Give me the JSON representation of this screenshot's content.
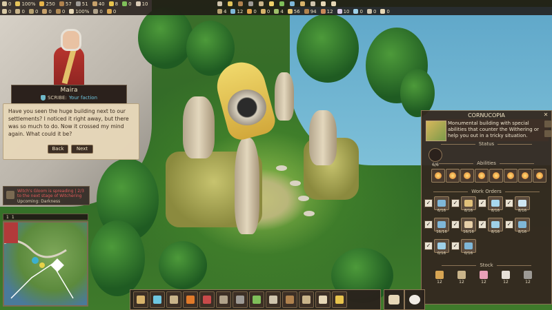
{
  "topbar": {
    "row1": [
      {
        "icon": "population-icon",
        "value": "0",
        "color": "#d8c9a5"
      },
      {
        "icon": "happiness-icon",
        "value": "100%",
        "color": "#e6c45a"
      },
      {
        "icon": "food-icon",
        "value": "250",
        "color": "#e7b44a"
      },
      {
        "icon": "wood-icon",
        "value": "57",
        "color": "#b0824e"
      },
      {
        "icon": "stone-icon",
        "value": "51",
        "color": "#9d9a95"
      },
      {
        "icon": "tool-icon",
        "value": "40",
        "color": "#c7a16b"
      },
      {
        "icon": "coin-icon",
        "value": "8",
        "color": "#e8c44d"
      },
      {
        "icon": "leaf-icon",
        "value": "0",
        "color": "#7fbf5a"
      },
      {
        "icon": "cloth-icon",
        "value": "10",
        "color": "#d9c9b5"
      }
    ],
    "row2": [
      {
        "icon": "scribe-icon",
        "value": "0",
        "color": "#d8c9a5"
      },
      {
        "icon": "worker-icon",
        "value": "0",
        "color": "#c9b48a"
      },
      {
        "icon": "explorer-icon",
        "value": "0",
        "color": "#b6a070"
      },
      {
        "icon": "trader-icon",
        "value": "0",
        "color": "#c7a16b"
      },
      {
        "icon": "crafter-icon",
        "value": "0",
        "color": "#b08a55"
      },
      {
        "icon": "vitality-icon",
        "value": "100%",
        "color": "#e6d7b6"
      },
      {
        "icon": "building-icon",
        "value": "0",
        "color": "#b0a28a"
      },
      {
        "icon": "bread-icon",
        "value": "0",
        "color": "#d7a553"
      }
    ],
    "right": [
      {
        "icon": "hammer-icon",
        "value": "",
        "color": "#cfc4ad"
      },
      {
        "icon": "wheat-icon",
        "value": "",
        "color": "#e2c45a"
      },
      {
        "icon": "log-icon",
        "value": "",
        "color": "#b0824e"
      },
      {
        "icon": "ore-icon",
        "value": "",
        "color": "#9d9a95"
      },
      {
        "icon": "pick-icon",
        "value": "",
        "color": "#c9b48a"
      },
      {
        "icon": "sun-icon",
        "value": "",
        "color": "#f0d06a"
      },
      {
        "icon": "herb-icon",
        "value": "",
        "color": "#7fbf5a"
      },
      {
        "icon": "gem-icon",
        "value": "",
        "color": "#7fb7d8"
      },
      {
        "icon": "trade-icon",
        "value": "",
        "color": "#d7b36b"
      },
      {
        "icon": "swords-icon",
        "value": "",
        "color": "#cfc4ad"
      },
      {
        "icon": "scroll-icon",
        "value": "",
        "color": "#e6d7b6"
      },
      {
        "icon": "menu-icon",
        "value": "",
        "color": "#e6d7b6"
      }
    ],
    "right2": [
      {
        "icon": "sap-icon",
        "value": "4",
        "color": "#b6a070"
      },
      {
        "icon": "glass-icon",
        "value": "12",
        "color": "#7fb7d8"
      },
      {
        "icon": "amber-icon",
        "value": "0",
        "color": "#e2a04a"
      },
      {
        "icon": "grain-icon",
        "value": "0",
        "color": "#d7b36b"
      },
      {
        "icon": "fiber-icon",
        "value": "4",
        "color": "#9fbf6a"
      },
      {
        "icon": "candle-icon",
        "value": "56",
        "color": "#e7c46a"
      },
      {
        "icon": "plank-icon",
        "value": "94",
        "color": "#b0824e"
      },
      {
        "icon": "clay-icon",
        "value": "12",
        "color": "#c98a5a"
      },
      {
        "icon": "silk-icon",
        "value": "10",
        "color": "#d9c9e5"
      },
      {
        "icon": "crystal-icon",
        "value": "0",
        "color": "#9fd0e8"
      },
      {
        "icon": "relic-icon",
        "value": "0",
        "color": "#cfc4ad"
      },
      {
        "icon": "book-icon",
        "value": "0",
        "color": "#e6d7b6"
      }
    ]
  },
  "character": {
    "name": "Maira",
    "role_prefix": "SCRIBE:",
    "role_faction": "Your faction"
  },
  "dialog": {
    "text": "Have you seen the huge building next to our settlements? I noticed it right away, but there was so much to do. Now it crossed my mind again. What could it be?",
    "back_label": "Back",
    "next_label": "Next"
  },
  "notification": {
    "line1": "Witch's Gloom is spreading | 2/3 to the next stage of Witchering",
    "line2": "Upcoming: Darkness"
  },
  "minimap": {
    "level": "1",
    "speed": "1"
  },
  "cornucopia": {
    "title": "CORNUCOPIA",
    "description": "Monumental building with special abilities that counter the Withering or help you out in a tricky situation.",
    "status_label": "Status",
    "status_value": "6/6",
    "abilities_label": "Abilities",
    "abilities": [
      {
        "icon": "ability-sun-icon"
      },
      {
        "icon": "ability-gem-icon"
      },
      {
        "icon": "ability-wind-icon"
      },
      {
        "icon": "ability-bloom-icon"
      },
      {
        "icon": "ability-shield-icon"
      },
      {
        "icon": "ability-flame-icon"
      },
      {
        "icon": "ability-star-icon"
      },
      {
        "icon": "ability-spark-icon"
      }
    ],
    "work_orders_label": "Work Orders",
    "work_orders": [
      {
        "icon": "order-house-icon",
        "count": "6/16",
        "color": "#7fb7d8"
      },
      {
        "icon": "order-fence-icon",
        "count": "8/16",
        "color": "#e0c07a"
      },
      {
        "icon": "order-crystal-icon",
        "count": "8/16",
        "color": "#a8d8ee"
      },
      {
        "icon": "order-cube-icon",
        "count": "8/16",
        "color": "#cfe6f2"
      },
      {
        "icon": "order-ring-icon",
        "count": "16/16",
        "color": "#7fb7d8"
      },
      {
        "icon": "order-shell-icon",
        "count": "16/16",
        "color": "#e7cfa8"
      },
      {
        "icon": "order-pearl-icon",
        "count": "8/16",
        "color": "#9fd0e8"
      },
      {
        "icon": "order-orb-icon",
        "count": "8/16",
        "color": "#7fb7d8"
      },
      {
        "icon": "order-potion-icon",
        "count": "0/16",
        "color": "#9fd0e8"
      },
      {
        "icon": "order-flask-icon",
        "count": "0/16",
        "color": "#7fb7d8"
      }
    ],
    "stock_label": "Stock",
    "stock": [
      {
        "icon": "stock-wheat-icon",
        "value": "12",
        "color": "#d7a553"
      },
      {
        "icon": "stock-torch-icon",
        "value": "12",
        "color": "#c9b48a"
      },
      {
        "icon": "stock-flower-icon",
        "value": "12",
        "color": "#e8a0b8"
      },
      {
        "icon": "stock-feather-icon",
        "value": "12",
        "color": "#e6e0d8"
      },
      {
        "icon": "stock-ore-icon",
        "value": "12",
        "color": "#9d9a95"
      }
    ]
  },
  "toolbar": {
    "items": [
      {
        "icon": "build-boot-icon",
        "color": "#d7b36b"
      },
      {
        "icon": "flag-icon",
        "color": "#6ec6e0"
      },
      {
        "icon": "saw-icon",
        "color": "#c9b48a"
      },
      {
        "icon": "fire-icon",
        "color": "#e07a2a"
      },
      {
        "icon": "berry-icon",
        "color": "#c84a4a"
      },
      {
        "icon": "gear-icon",
        "color": "#b0a28a"
      },
      {
        "icon": "anvil-icon",
        "color": "#9d9a95"
      },
      {
        "icon": "tree-icon",
        "color": "#7fbf5a"
      },
      {
        "icon": "hammer-icon",
        "color": "#cfc4ad"
      },
      {
        "icon": "axe-icon",
        "color": "#b0824e"
      },
      {
        "icon": "shovel-icon",
        "color": "#c9b48a"
      },
      {
        "icon": "house-icon",
        "color": "#e6d7b6"
      },
      {
        "icon": "torch-icon",
        "color": "#e8c44d"
      }
    ],
    "extra1": {
      "icon": "camp-icon",
      "color": "#e6d7b6"
    },
    "extra2": {
      "icon": "egg-icon",
      "color": "#f0ece4"
    }
  }
}
